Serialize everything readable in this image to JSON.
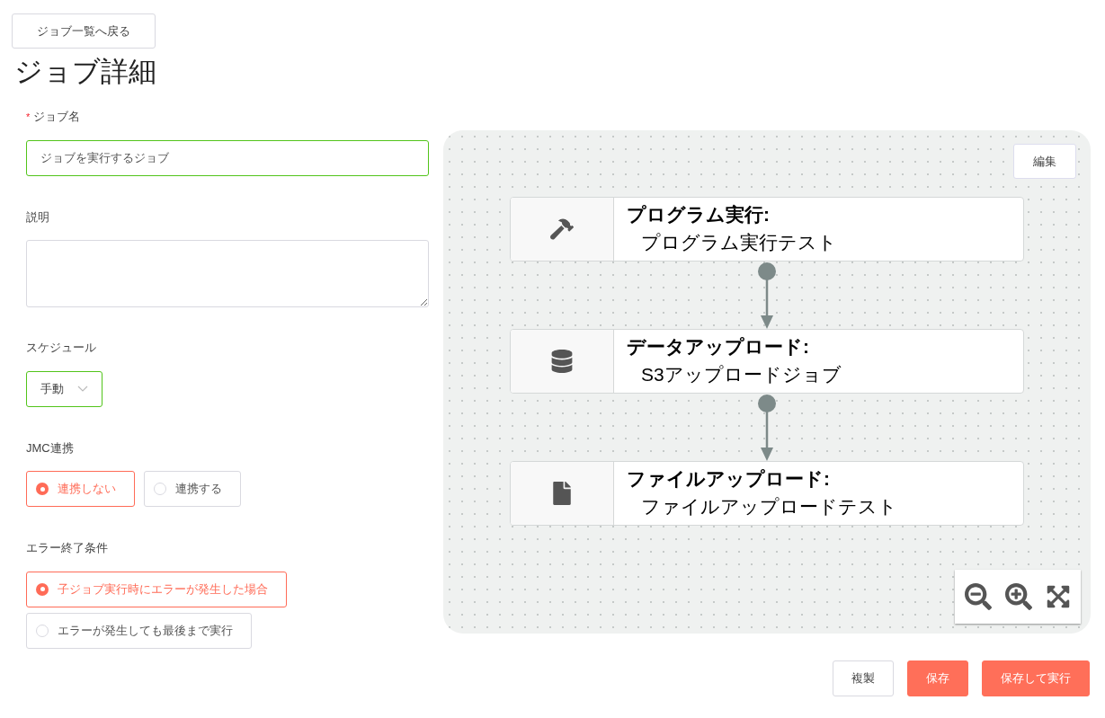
{
  "back_button": "ジョブ一覧へ戻る",
  "title": "ジョブ詳細",
  "form": {
    "job_name": {
      "label": "ジョブ名",
      "required_mark": "*",
      "value": "ジョブを実行するジョブ"
    },
    "description": {
      "label": "説明"
    },
    "schedule": {
      "label": "スケジュール",
      "value": "手動"
    },
    "jmc": {
      "label": "JMC連携",
      "options": [
        {
          "label": "連携しない",
          "selected": true
        },
        {
          "label": "連携する",
          "selected": false
        }
      ]
    },
    "error_condition": {
      "label": "エラー終了条件",
      "options": [
        {
          "label": "子ジョブ実行時にエラーが発生した場合",
          "selected": true
        },
        {
          "label": "エラーが発生しても最後まで実行",
          "selected": false
        }
      ]
    }
  },
  "canvas": {
    "edit_button": "編集",
    "nodes": [
      {
        "kind": "program",
        "title": "プログラム実行:",
        "subtitle": "プログラム実行テスト"
      },
      {
        "kind": "data_upload",
        "title": "データアップロード:",
        "subtitle": "S3アップロードジョブ"
      },
      {
        "kind": "file_upload",
        "title": "ファイルアップロード:",
        "subtitle": "ファイルアップロードテスト"
      }
    ]
  },
  "actions": [
    {
      "label": "複製",
      "kind": "secondary"
    },
    {
      "label": "保存",
      "kind": "primary"
    },
    {
      "label": "保存して実行",
      "kind": "primary"
    }
  ]
}
